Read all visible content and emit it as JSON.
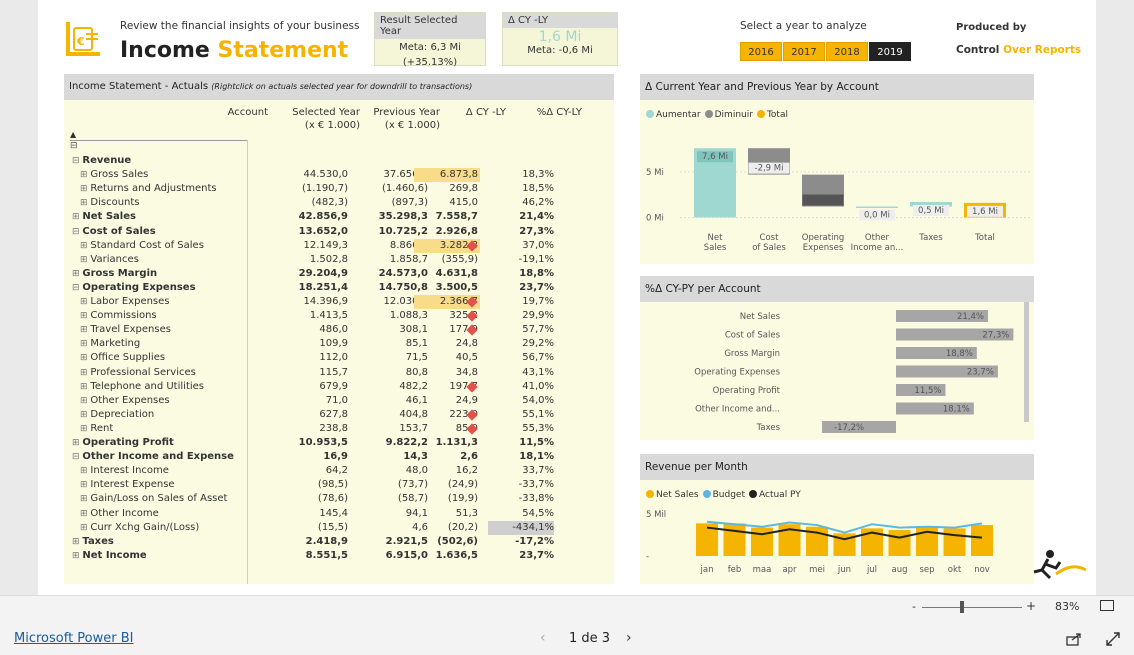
{
  "header": {
    "subtitle": "Review the financial insights of your business",
    "title_main": "Income Statement",
    "title_word1": "Income",
    "title_word2": "Statement"
  },
  "kpi_selected": {
    "head": "Result Selected Year",
    "meta": "Meta: 6,3 Mi",
    "pct": "(+35.13%)"
  },
  "kpi_delta": {
    "head": "Δ CY -LY",
    "value": "1,6 Mi",
    "meta": "Meta: -0,6 Mi"
  },
  "year_picker": {
    "label": "Select a year to analyze",
    "years": [
      "2016",
      "2017",
      "2018",
      "2019"
    ],
    "selected": "2019"
  },
  "produced": {
    "label": "Produced by",
    "brand1": "Control",
    "brand2": "Over Reports"
  },
  "table": {
    "title": "Income Statement - Actuals",
    "title_note": "(Rightclick on actuals selected year for downdrill to transactions)",
    "columns": [
      "Account",
      "Selected Year",
      "Previous Year",
      "Δ CY -LY",
      "%Δ CY-LY"
    ],
    "col_units": [
      "",
      "(x € 1.000)",
      "(x € 1.000)",
      "",
      ""
    ],
    "rows": [
      {
        "label": "Revenue",
        "lvl": 0,
        "cy": "",
        "py": "",
        "d": "",
        "p": "",
        "bold": true,
        "sign": "⊟"
      },
      {
        "label": "Gross Sales",
        "lvl": 1,
        "cy": "44.530,0",
        "py": "37.656,2",
        "d": "6.873,8",
        "p": "18,3%",
        "bold": false,
        "sign": "⊞",
        "hl": true
      },
      {
        "label": "Returns and Adjustments",
        "lvl": 1,
        "cy": "(1.190,7)",
        "py": "(1.460,6)",
        "d": "269,8",
        "p": "18,5%",
        "bold": false,
        "sign": "⊞"
      },
      {
        "label": "Discounts",
        "lvl": 1,
        "cy": "(482,3)",
        "py": "(897,3)",
        "d": "415,0",
        "p": "46,2%",
        "bold": false,
        "sign": "⊞"
      },
      {
        "label": "Net Sales",
        "lvl": 0,
        "cy": "42.856,9",
        "py": "35.298,3",
        "d": "7.558,7",
        "p": "21,4%",
        "bold": true,
        "sign": "⊞"
      },
      {
        "label": "Cost of Sales",
        "lvl": 0,
        "cy": "13.652,0",
        "py": "10.725,2",
        "d": "2.926,8",
        "p": "27,3%",
        "bold": true,
        "sign": "⊟"
      },
      {
        "label": "Standard Cost of Sales",
        "lvl": 1,
        "cy": "12.149,3",
        "py": "8.866,5",
        "d": "3.282,8",
        "p": "37,0%",
        "bold": false,
        "sign": "⊞",
        "hl": true,
        "flag": true
      },
      {
        "label": "Variances",
        "lvl": 1,
        "cy": "1.502,8",
        "py": "1.858,7",
        "d": "(355,9)",
        "p": "-19,1%",
        "bold": false,
        "sign": "⊞"
      },
      {
        "label": "Gross Margin",
        "lvl": 0,
        "cy": "29.204,9",
        "py": "24.573,0",
        "d": "4.631,8",
        "p": "18,8%",
        "bold": true,
        "sign": "⊞"
      },
      {
        "label": "Operating Expenses",
        "lvl": 0,
        "cy": "18.251,4",
        "py": "14.750,8",
        "d": "3.500,5",
        "p": "23,7%",
        "bold": true,
        "sign": "⊟"
      },
      {
        "label": "Labor Expenses",
        "lvl": 1,
        "cy": "14.396,9",
        "py": "12.030,2",
        "d": "2.366,7",
        "p": "19,7%",
        "bold": false,
        "sign": "⊞",
        "hl": true,
        "flag": true
      },
      {
        "label": "Commissions",
        "lvl": 1,
        "cy": "1.413,5",
        "py": "1.088,3",
        "d": "325,2",
        "p": "29,9%",
        "bold": false,
        "sign": "⊞",
        "flag": true
      },
      {
        "label": "Travel Expenses",
        "lvl": 1,
        "cy": "486,0",
        "py": "308,1",
        "d": "177,9",
        "p": "57,7%",
        "bold": false,
        "sign": "⊞",
        "flag": true
      },
      {
        "label": "Marketing",
        "lvl": 1,
        "cy": "109,9",
        "py": "85,1",
        "d": "24,8",
        "p": "29,2%",
        "bold": false,
        "sign": "⊞"
      },
      {
        "label": "Office Supplies",
        "lvl": 1,
        "cy": "112,0",
        "py": "71,5",
        "d": "40,5",
        "p": "56,7%",
        "bold": false,
        "sign": "⊞"
      },
      {
        "label": "Professional Services",
        "lvl": 1,
        "cy": "115,7",
        "py": "80,8",
        "d": "34,8",
        "p": "43,1%",
        "bold": false,
        "sign": "⊞"
      },
      {
        "label": "Telephone and Utilities",
        "lvl": 1,
        "cy": "679,9",
        "py": "482,2",
        "d": "197,7",
        "p": "41,0%",
        "bold": false,
        "sign": "⊞",
        "flag": true
      },
      {
        "label": "Other Expenses",
        "lvl": 1,
        "cy": "71,0",
        "py": "46,1",
        "d": "24,9",
        "p": "54,0%",
        "bold": false,
        "sign": "⊞"
      },
      {
        "label": "Depreciation",
        "lvl": 1,
        "cy": "627,8",
        "py": "404,8",
        "d": "223,0",
        "p": "55,1%",
        "bold": false,
        "sign": "⊞",
        "flag": true
      },
      {
        "label": "Rent",
        "lvl": 1,
        "cy": "238,8",
        "py": "153,7",
        "d": "85,0",
        "p": "55,3%",
        "bold": false,
        "sign": "⊞",
        "flag": true
      },
      {
        "label": "Operating Profit",
        "lvl": 0,
        "cy": "10.953,5",
        "py": "9.822,2",
        "d": "1.131,3",
        "p": "11,5%",
        "bold": true,
        "sign": "⊞"
      },
      {
        "label": "Other Income and Expense",
        "lvl": 0,
        "cy": "16,9",
        "py": "14,3",
        "d": "2,6",
        "p": "18,1%",
        "bold": true,
        "sign": "⊟"
      },
      {
        "label": "Interest Income",
        "lvl": 1,
        "cy": "64,2",
        "py": "48,0",
        "d": "16,2",
        "p": "33,7%",
        "bold": false,
        "sign": "⊞"
      },
      {
        "label": "Interest Expense",
        "lvl": 1,
        "cy": "(98,5)",
        "py": "(73,7)",
        "d": "(24,9)",
        "p": "-33,7%",
        "bold": false,
        "sign": "⊞"
      },
      {
        "label": "Gain/Loss on Sales of Asset",
        "lvl": 1,
        "cy": "(78,6)",
        "py": "(58,7)",
        "d": "(19,9)",
        "p": "-33,8%",
        "bold": false,
        "sign": "⊞"
      },
      {
        "label": "Other Income",
        "lvl": 1,
        "cy": "145,4",
        "py": "94,1",
        "d": "51,3",
        "p": "54,5%",
        "bold": false,
        "sign": "⊞"
      },
      {
        "label": "Curr Xchg Gain/(Loss)",
        "lvl": 1,
        "cy": "(15,5)",
        "py": "4,6",
        "d": "(20,2)",
        "p": "-434,1%",
        "bold": false,
        "sign": "⊞",
        "pgray": true
      },
      {
        "label": "Taxes",
        "lvl": 0,
        "cy": "2.418,9",
        "py": "2.921,5",
        "d": "(502,6)",
        "p": "-17,2%",
        "bold": true,
        "sign": "⊞"
      },
      {
        "label": "Net Income",
        "lvl": 0,
        "cy": "8.551,5",
        "py": "6.915,0",
        "d": "1.636,5",
        "p": "23,7%",
        "bold": true,
        "sign": "⊞"
      }
    ]
  },
  "waterfall": {
    "title": "Δ Current Year and Previous Year by Account",
    "legend": [
      {
        "name": "Aumentar",
        "color": "#9fd8d0"
      },
      {
        "name": "Diminuir",
        "color": "#8c8c8c"
      },
      {
        "name": "Total",
        "color": "#f5b400"
      }
    ],
    "y_ticks": [
      "5 Mi",
      "0 Mi"
    ],
    "chart_data": {
      "type": "bar",
      "categories": [
        "Net Sales",
        "Cost of Sales",
        "Operating Expenses",
        "Other Income an...",
        "Taxes",
        "Total"
      ],
      "values": [
        7.6,
        -2.9,
        -3.5,
        0.0,
        0.5,
        1.6
      ],
      "labels": [
        "7,6 Mi",
        "-2,9 Mi",
        "-3,5 Mi",
        "0,0 Mi",
        "0,5 Mi",
        "1,6 Mi"
      ],
      "ylim": [
        -0.5,
        8.5
      ]
    }
  },
  "pct_chart": {
    "title": "%Δ CY-PY per Account",
    "chart_data": {
      "type": "bar",
      "categories": [
        "Net Sales",
        "Cost of Sales",
        "Gross Margin",
        "Operating Expenses",
        "Operating Profit",
        "Other Income and...",
        "Taxes"
      ],
      "values": [
        21.4,
        27.3,
        18.8,
        23.7,
        11.5,
        18.1,
        -17.2
      ],
      "labels": [
        "21,4%",
        "27,3%",
        "18,8%",
        "23,7%",
        "11,5%",
        "18,1%",
        "-17,2%"
      ]
    }
  },
  "revenue_chart": {
    "title": "Revenue  per Month",
    "legend": [
      {
        "name": "Net Sales",
        "color": "#f5b400"
      },
      {
        "name": "Budget",
        "color": "#5bb8e0"
      },
      {
        "name": "Actual PY",
        "color": "#222222"
      }
    ],
    "y_ticks": [
      "5 Mil",
      "-"
    ],
    "chart_data": {
      "type": "bar",
      "categories": [
        "jan",
        "feb",
        "maa",
        "apr",
        "mei",
        "jun",
        "jul",
        "aug",
        "sep",
        "okt",
        "nov"
      ],
      "series": [
        {
          "name": "Net Sales",
          "values": [
            3.9,
            3.9,
            3.4,
            3.8,
            3.5,
            2.7,
            3.3,
            3.1,
            3.5,
            3.3,
            3.7
          ]
        },
        {
          "name": "Budget",
          "values": [
            4.1,
            3.8,
            3.5,
            4.0,
            3.7,
            2.8,
            3.8,
            3.4,
            3.5,
            3.4,
            3.9
          ]
        },
        {
          "name": "Actual PY",
          "values": [
            3.4,
            3.0,
            2.6,
            3.2,
            2.8,
            2.0,
            2.8,
            2.2,
            2.9,
            2.5,
            2.2
          ]
        }
      ],
      "ylim": [
        0,
        5.5
      ]
    }
  },
  "footer": {
    "pbi_link": "Microsoft Power BI",
    "page": "1 de 3",
    "zoom": "83%"
  }
}
